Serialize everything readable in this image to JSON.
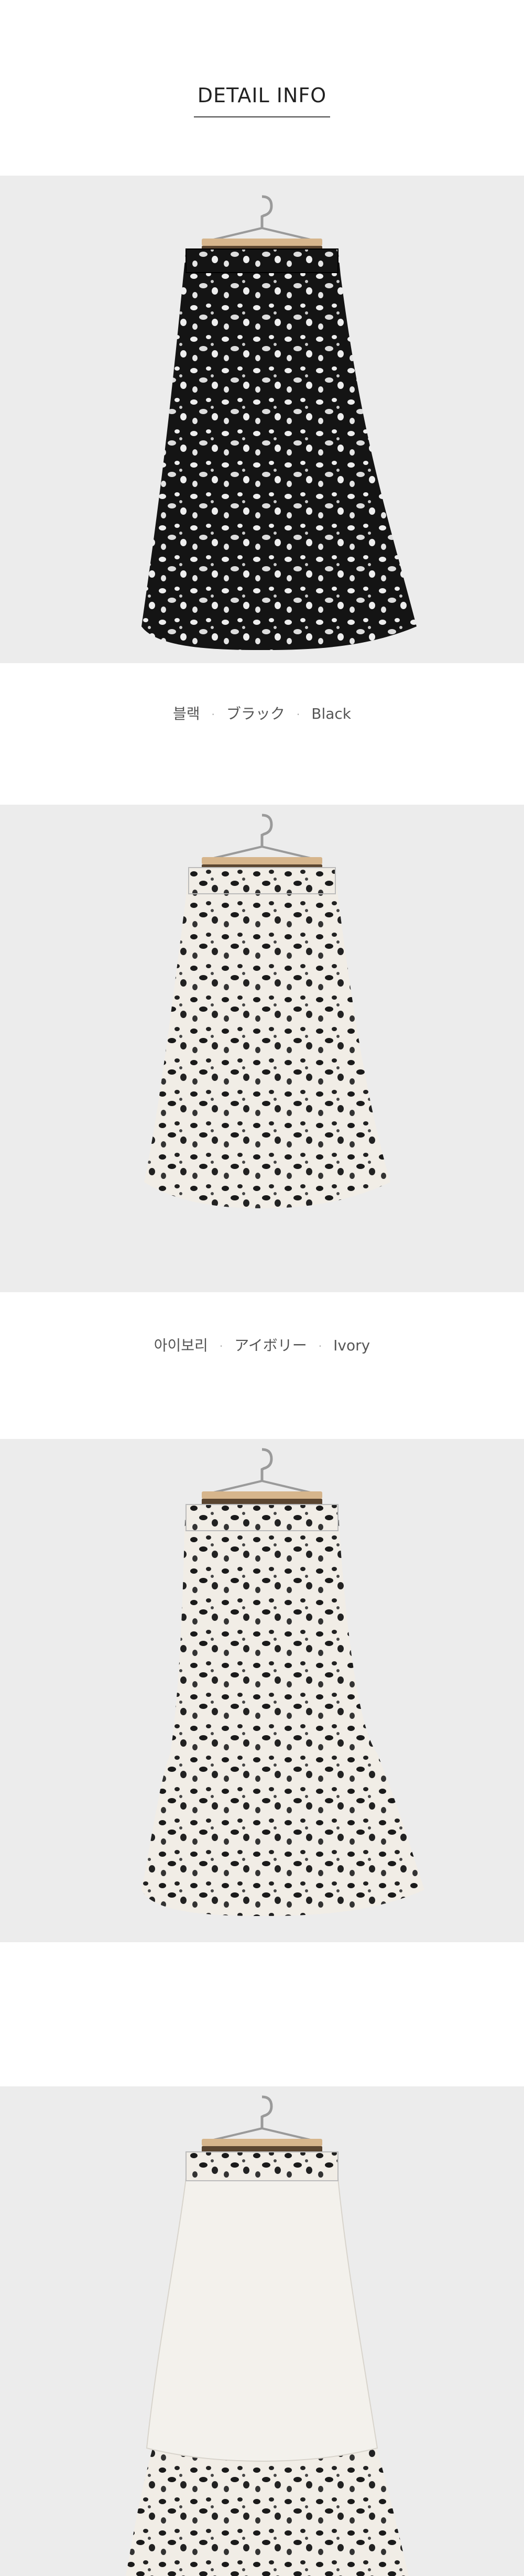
{
  "header": {
    "title": "DETAIL INFO"
  },
  "colors": {
    "background": "#ececec",
    "black_skirt": "#141414",
    "ivory_skirt": "#f1ede6",
    "hanger": "#9a9a9a",
    "hanger_wood": "#d6b58c"
  },
  "sections": [
    {
      "image": "black-leopard-skirt-photo",
      "caption": [
        "블랙",
        "ブラック",
        "Black"
      ]
    },
    {
      "image": "ivory-leopard-skirt-photo",
      "caption": [
        "아이보리",
        "アイボリー",
        "Ivory"
      ]
    },
    {
      "image": "ivory-leopard-skirt-photo-2"
    },
    {
      "image": "ivory-skirt-lining-photo"
    }
  ]
}
